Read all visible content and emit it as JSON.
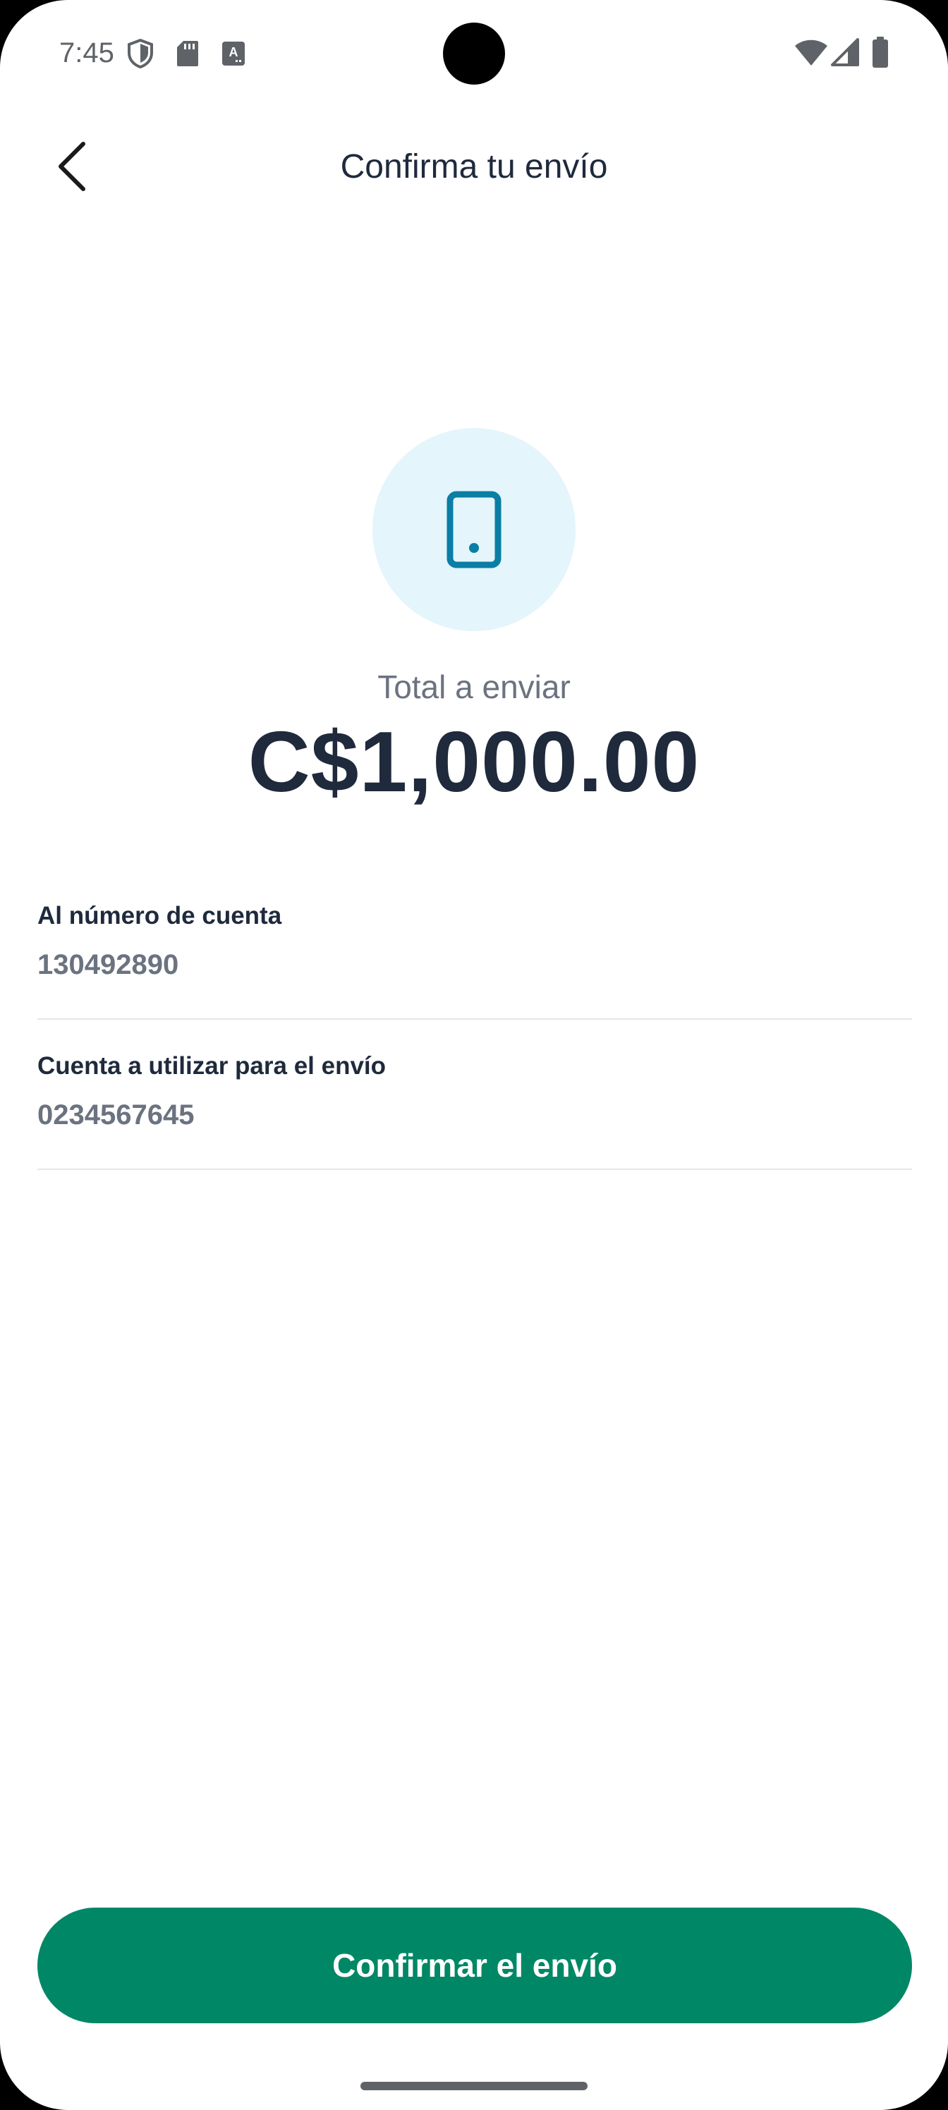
{
  "status_bar": {
    "time": "7:45",
    "left_icons": [
      "shield-icon",
      "sd-card-icon",
      "keyboard-a-icon"
    ],
    "right_icons": [
      "wifi-icon",
      "signal-icon",
      "battery-icon"
    ]
  },
  "header": {
    "back_icon": "chevron-left-icon",
    "title": "Confirma tu envío"
  },
  "summary": {
    "icon": "mobile-phone-icon",
    "total_label": "Total a enviar",
    "total_amount": "C$1,000.00"
  },
  "details": [
    {
      "label": "Al número de cuenta",
      "value": "130492890"
    },
    {
      "label": "Cuenta a utilizar para el envío",
      "value": "0234567645"
    }
  ],
  "actions": {
    "confirm_label": "Confirmar el envío"
  },
  "colors": {
    "primary": "#008766",
    "text_dark": "#1f2a3c",
    "text_muted": "#6b7280",
    "icon_blue": "#0a7ea4",
    "icon_bg": "#e4f5fb",
    "divider": "#e5e7eb"
  }
}
